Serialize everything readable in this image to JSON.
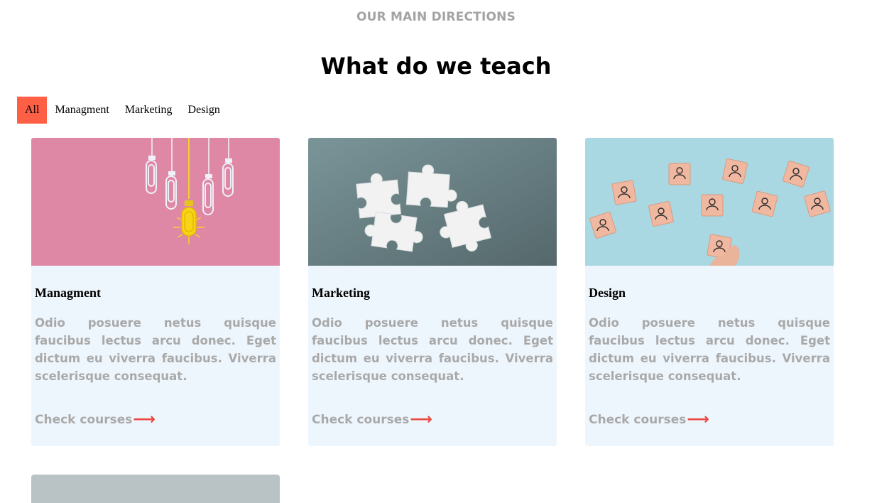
{
  "section": {
    "eyebrow": "OUR MAIN DIRECTIONS",
    "title": "What do we teach"
  },
  "filters": [
    {
      "label": "All",
      "active": true
    },
    {
      "label": "Managment",
      "active": false
    },
    {
      "label": "Marketing",
      "active": false
    },
    {
      "label": "Design",
      "active": false
    }
  ],
  "cards": [
    {
      "image": "paperclips-lightbulb-image",
      "title": "Managment",
      "text": "Odio posuere netus quisque faucibus lectus arcu donec. Eget dictum eu viverra faucibus. Viverra scelerisque consequat.",
      "link": "Check courses"
    },
    {
      "image": "puzzle-pieces-image",
      "title": "Marketing",
      "text": "Odio posuere netus quisque faucibus lectus arcu donec. Eget dictum eu viverra faucibus. Viverra scelerisque consequat.",
      "link": "Check courses"
    },
    {
      "image": "wooden-cubes-people-image",
      "title": "Design",
      "text": "Odio posuere netus quisque faucibus lectus arcu donec. Eget dictum eu viverra faucibus. Viverra scelerisque consequat.",
      "link": "Check courses"
    }
  ],
  "colors": {
    "accent": "#ff5f45",
    "arrow": "#ea4a42",
    "card_bg": "#eef6fd",
    "muted_text": "#a9a9a9"
  }
}
